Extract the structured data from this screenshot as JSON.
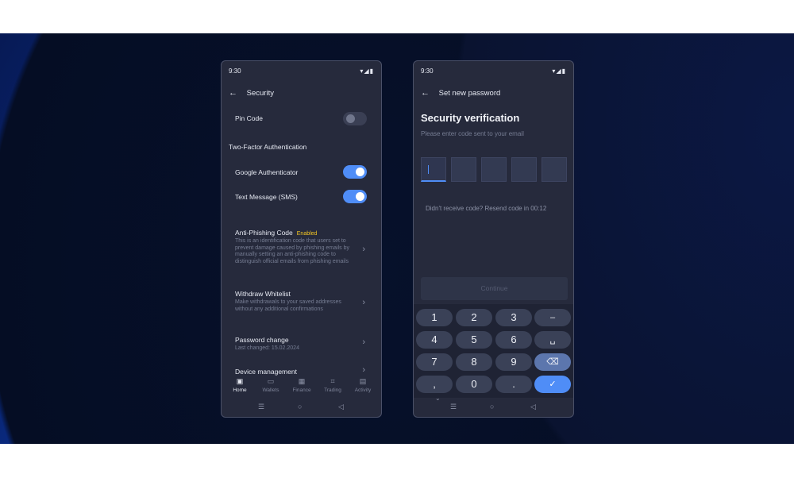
{
  "left_phone": {
    "status": {
      "time": "9:30",
      "icons": "▾◢▮"
    },
    "header": {
      "back": "←",
      "title": "Security"
    },
    "pin": {
      "label": "Pin Code",
      "enabled": false
    },
    "two_factor": {
      "title": "Two-Factor Authentication",
      "google": {
        "label": "Google Authenticator",
        "enabled": true
      },
      "sms": {
        "label": "Text Message (SMS)",
        "enabled": true
      }
    },
    "anti_phishing": {
      "title": "Anti-Phishing Code",
      "badge": "Enabled",
      "desc": "This is an identification code that users set to prevent damage caused by phishing emails by manually setting an anti-phishing code to distinguish official emails from phishing emails"
    },
    "withdraw": {
      "title": "Withdraw Whitelist",
      "desc": "Make withdrawals to your saved addresses without any additional confirmations"
    },
    "password": {
      "title": "Password change",
      "desc": "Last changed: 15.02.2024"
    },
    "device": {
      "title": "Device management"
    },
    "chevron": "›",
    "nav": [
      {
        "label": "Home",
        "icon": "▣"
      },
      {
        "label": "Wallets",
        "icon": "▭"
      },
      {
        "label": "Finance",
        "icon": "▦"
      },
      {
        "label": "Trading",
        "icon": "⌗"
      },
      {
        "label": "Activity",
        "icon": "▤"
      }
    ],
    "sysbar": {
      "menu": "☰",
      "home": "○",
      "back": "◁"
    }
  },
  "right_phone": {
    "status": {
      "time": "9:30",
      "icons": "▾◢▮"
    },
    "header": {
      "back": "←",
      "title": "Set new password"
    },
    "title": "Security verification",
    "subtitle": "Please enter code sent to your email",
    "code_caret": "|",
    "resend": "Didn't receive code?  Resend code in 00:12",
    "continue_label": "Continue",
    "keys": {
      "k1": "1",
      "k2": "2",
      "k3": "3",
      "minus": "–",
      "k4": "4",
      "k5": "5",
      "k6": "6",
      "space": "␣",
      "k7": "7",
      "k8": "8",
      "k9": "9",
      "del": "⌫",
      "comma": ",",
      "k0": "0",
      "dot": ".",
      "done": "✓"
    },
    "hide_keyboard": "⌄",
    "sysbar": {
      "menu": "☰",
      "home": "○",
      "back": "◁"
    }
  }
}
